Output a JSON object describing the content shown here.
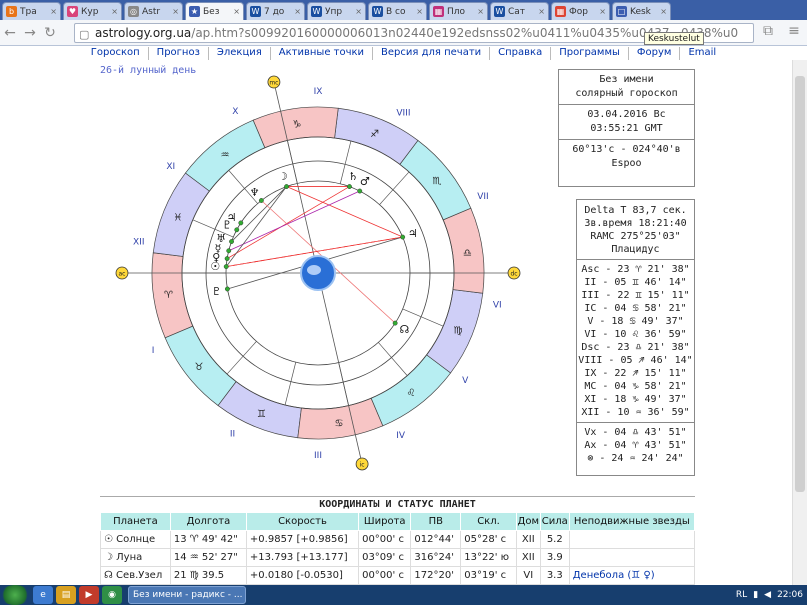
{
  "tabs": [
    {
      "label": "Тра",
      "color": "#e8741a",
      "icon": "b"
    },
    {
      "label": "Кур",
      "color": "#d9447a",
      "icon": "♥"
    },
    {
      "label": "Astr",
      "color": "#888888",
      "icon": "◎"
    },
    {
      "label": "Без",
      "color": "#3b5db0",
      "icon": "★",
      "active": true
    },
    {
      "label": "7 до",
      "color": "#1a4fa0",
      "icon": "W"
    },
    {
      "label": "Упр",
      "color": "#1a4fa0",
      "icon": "W"
    },
    {
      "label": "В со",
      "color": "#1a4fa0",
      "icon": "W"
    },
    {
      "label": "Пло",
      "color": "#c0307a",
      "icon": "▦"
    },
    {
      "label": "Сат",
      "color": "#1a4fa0",
      "icon": "W"
    },
    {
      "label": "Фор",
      "color": "#dd4433",
      "icon": "▦"
    },
    {
      "label": "Kesk",
      "color": "#3b5db0",
      "icon": "□"
    }
  ],
  "tooltip": "Keskustelut",
  "url": {
    "host": "astrology.org.ua",
    "path": "/ap.htm?s009920160000006013n02440e192edsnss02%u0411%u0435%u0437...0438%u0"
  },
  "menu": [
    "Гороскоп",
    "Прогноз",
    "Элекция",
    "Активные точки",
    "Версия для печати",
    "Справка",
    "Программы",
    "Форум",
    "Email"
  ],
  "lunar_day": "26-й лунный день",
  "chart": {
    "houses_outer": [
      "I",
      "II",
      "III",
      "IV",
      "V",
      "VI",
      "VII",
      "VIII",
      "IX",
      "X",
      "XI",
      "XII"
    ],
    "markers": [
      "ac",
      "ic",
      "dc",
      "mc"
    ],
    "signs": [
      "♈",
      "♉",
      "♊",
      "♋",
      "♌",
      "♍",
      "♎",
      "♏",
      "♐",
      "♑",
      "♒",
      "♓"
    ],
    "planets": [
      "☽",
      "☉",
      "♆",
      "♅",
      "♇",
      "♄",
      "♂",
      "♀",
      "☿",
      "♃",
      "☊",
      "♃",
      "♇"
    ]
  },
  "info": {
    "name": "Без имени",
    "type": "солярный гороскоп",
    "date": "03.04.2016 Вс",
    "time": "03:55:21 GMT",
    "coords": "60°13'с - 024°40'в",
    "place": "Espoo",
    "delta": "Delta T  83,7 сек.",
    "sidereal": "Зв.время 18:21:40",
    "ramc": "RAMC 275°25'03\"",
    "system": "Плацидус",
    "cusps": [
      "Asc - 23 ♈ 21' 38\"",
      "II - 05 ♊ 46' 14\"",
      "III - 22 ♊ 15' 11\"",
      "IC - 04 ♋ 58' 21\"",
      "V - 18 ♋ 49' 37\"",
      "VI - 10 ♌ 36' 59\"",
      "Dsc - 23 ♎ 21' 38\"",
      "VIII - 05 ♐ 46' 14\"",
      "IX - 22 ♐ 15' 11\"",
      "MC - 04 ♑ 58' 21\"",
      "XI - 18 ♑ 49' 37\"",
      "XII - 10 ♒ 36' 59\""
    ],
    "points": [
      "Vx - 04 ♎ 43' 51\"",
      "Ax - 04 ♈ 43' 51\"",
      "⊗ - 24 ♒ 24' 24\""
    ]
  },
  "table": {
    "title": "КООРДИНАТЫ И СТАТУС ПЛАНЕТ",
    "headers": [
      "Планета",
      "Долгота",
      "Скорость",
      "Широта",
      "ПВ",
      "Скл.",
      "Дом",
      "Сила",
      "Неподвижные звезды"
    ],
    "rows": [
      [
        "☉ Солнце",
        "13 ♈ 49' 42\"",
        "+0.9857  [+0.9856]",
        "00°00' с",
        "012°44'",
        "05°28' с",
        "XII",
        "5.2",
        ""
      ],
      [
        "☽ Луна",
        "14 ♒ 52' 27\"",
        "+13.793  [+13.177]",
        "03°09' с",
        "316°24'",
        "13°22' ю",
        "XII",
        "3.9",
        ""
      ],
      [
        "☊ Сев.Узел",
        "21 ♍ 39.5",
        "+0.0180  [-0.0530]",
        "00°00' с",
        "172°20'",
        "03°19' с",
        "VI",
        "3.3",
        "Денебола (♊ ♀)"
      ]
    ]
  },
  "taskbar": {
    "item": "Без имени - радикс - ...",
    "lang": "RL",
    "time": "22:06"
  }
}
